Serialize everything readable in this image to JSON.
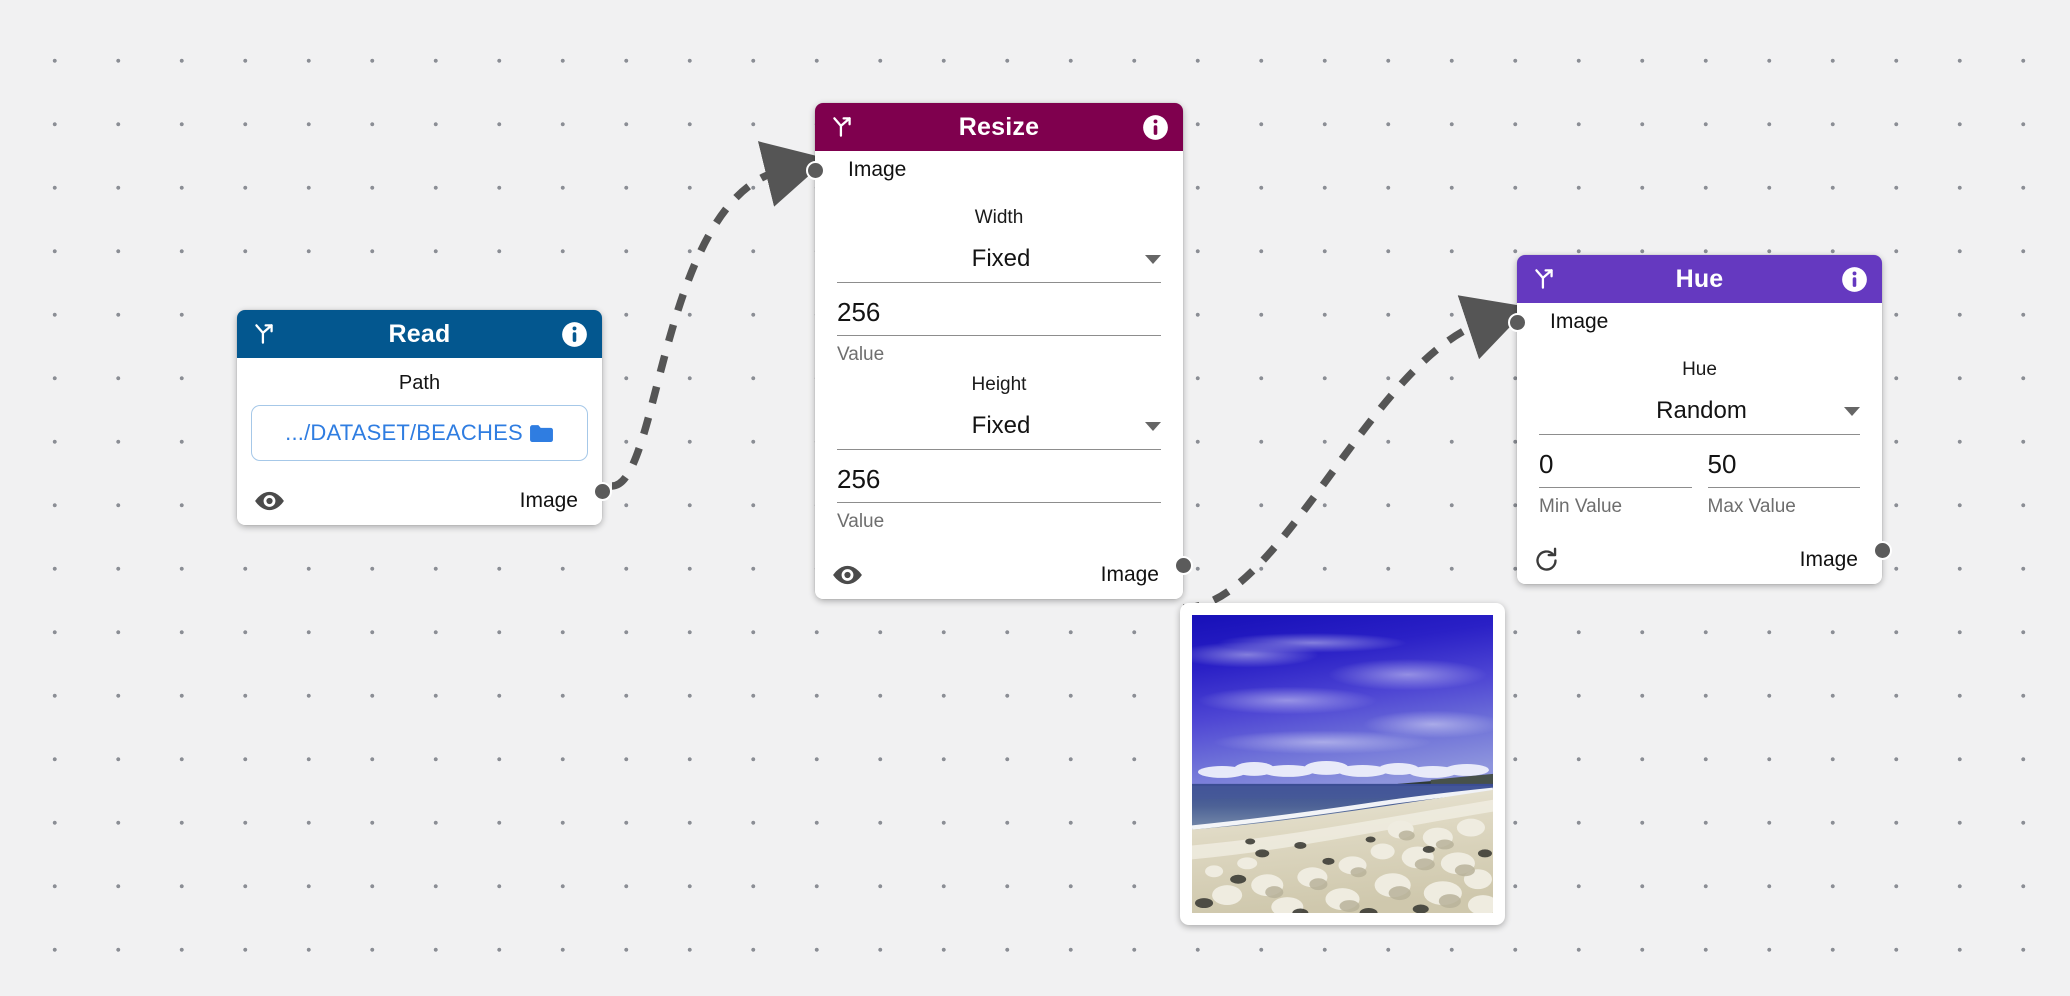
{
  "canvas": {
    "background_color": "#f1f1f2",
    "dot_color": "#8b8e95",
    "edge_color": "#555555"
  },
  "nodes": [
    {
      "id": "read",
      "title": "Read",
      "header_color": "#03578f",
      "header_icon": "branch-icon",
      "info_icon": "info-icon",
      "path_label": "Path",
      "path_value": ".../DATASET/BEACHES",
      "path_icon": "folder-icon",
      "footer_icon": "eye-icon",
      "output_label": "Image"
    },
    {
      "id": "resize",
      "title": "Resize",
      "header_color": "#7f004e",
      "header_icon": "branch-icon",
      "info_icon": "info-icon",
      "input_label": "Image",
      "width_label": "Width",
      "width_mode": "Fixed",
      "width_value": "256",
      "width_help": "Value",
      "height_label": "Height",
      "height_mode": "Fixed",
      "height_value": "256",
      "height_help": "Value",
      "footer_icon": "eye-icon",
      "output_label": "Image"
    },
    {
      "id": "hue",
      "title": "Hue",
      "header_color": "#6539c0",
      "header_icon": "branch-icon",
      "info_icon": "info-icon",
      "input_label": "Image",
      "hue_label": "Hue",
      "hue_mode": "Random",
      "min_value": "0",
      "min_help": "Min Value",
      "max_value": "50",
      "max_help": "Max Value",
      "footer_icon": "refresh-icon",
      "output_label": "Image"
    }
  ],
  "preview": {
    "name": "beach-preview-thumbnail",
    "description": "Beach photo with deep blue sky, white clouds, ocean and pebble shore"
  }
}
